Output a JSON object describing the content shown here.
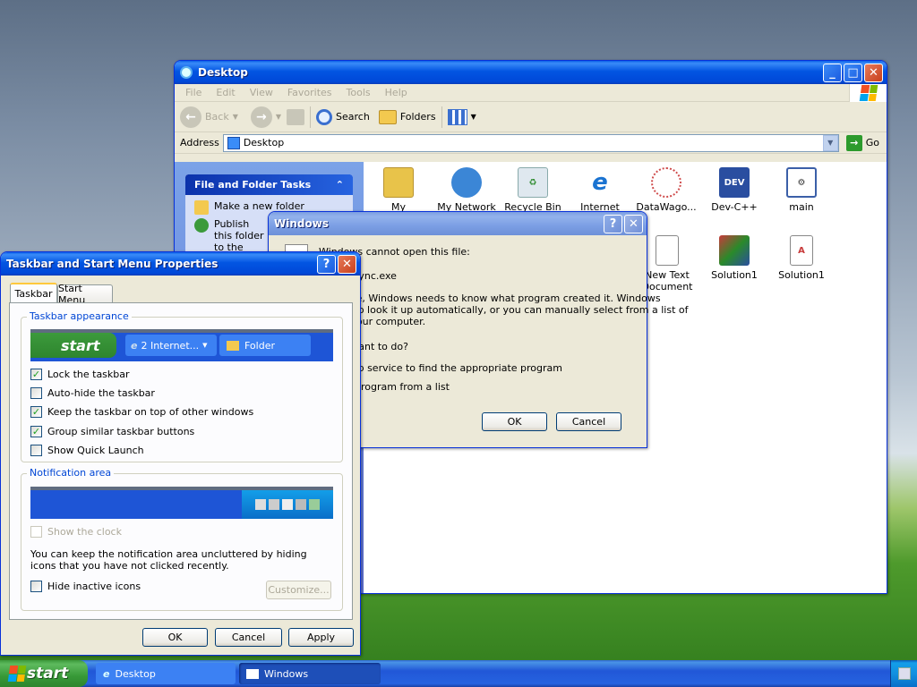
{
  "explorer": {
    "title": "Desktop",
    "menu": [
      "File",
      "Edit",
      "View",
      "Favorites",
      "Tools",
      "Help"
    ],
    "toolbar": {
      "back": "Back",
      "search": "Search",
      "folders": "Folders"
    },
    "address_label": "Address",
    "address_value": "Desktop",
    "go_label": "Go",
    "tasks_header": "File and Folder Tasks",
    "tasks": [
      "Make a new folder",
      "Publish this folder to the Web"
    ],
    "icons": [
      {
        "label": "My Documents",
        "icon": "folder-docs-icon",
        "color": "#e8c34a"
      },
      {
        "label": "My Network",
        "icon": "network-globe-icon",
        "color": "#3b86d6"
      },
      {
        "label": "Recycle Bin",
        "icon": "recycle-bin-icon",
        "color": "#6fae6f"
      },
      {
        "label": "Internet",
        "icon": "internet-explorer-icon",
        "color": "#1a73d1"
      },
      {
        "label": "DataWago...",
        "icon": "datawago-shortcut-icon",
        "color": "#cf4b4b"
      },
      {
        "label": "Dev-C++",
        "icon": "devcpp-shortcut-icon",
        "color": "#2a4ea0"
      },
      {
        "label": "main",
        "icon": "exe-window-icon",
        "color": "#5a5a5a"
      },
      {
        "label": "New Text Document",
        "icon": "text-document-icon",
        "color": "#ffffff"
      },
      {
        "label": "Solution1",
        "icon": "solution-file-icon",
        "color": "#c83b3b"
      },
      {
        "label": "Solution1",
        "icon": "solution-doc-icon",
        "color": "#ffffff"
      }
    ]
  },
  "windows_dialog": {
    "title": "Windows",
    "line1": "Windows cannot open this file:",
    "filename": "File: cbsync.exe",
    "line2a": "To open this file, Windows needs to know what program created it.  Windows",
    "line2b": "can go online to look it up automatically, or you can manually select from a list of",
    "line2c": "programs on your computer.",
    "question": "What do you want to do?",
    "opt1": "Use the Web service to find the appropriate program",
    "opt2": "Select the program from a list",
    "ok": "OK",
    "cancel": "Cancel"
  },
  "taskbar_props": {
    "title": "Taskbar and Start Menu Properties",
    "tabs": [
      "Taskbar",
      "Start Menu"
    ],
    "group1": "Taskbar appearance",
    "preview_start": "start",
    "preview_task1": "2 Internet...",
    "preview_task2": "Folder",
    "checks": [
      {
        "label": "Lock the taskbar",
        "checked": true
      },
      {
        "label": "Auto-hide the taskbar",
        "checked": false
      },
      {
        "label": "Keep the taskbar on top of other windows",
        "checked": true
      },
      {
        "label": "Group similar taskbar buttons",
        "checked": true
      },
      {
        "label": "Show Quick Launch",
        "checked": false
      }
    ],
    "group2": "Notification area",
    "show_clock": "Show the clock",
    "note": "You can keep the notification area uncluttered by hiding icons that you have not clicked recently.",
    "hide_inactive": "Hide inactive icons",
    "customize": "Customize...",
    "ok": "OK",
    "cancel": "Cancel",
    "apply": "Apply"
  },
  "taskbar": {
    "start": "start",
    "tasks": [
      "Desktop",
      "Windows"
    ]
  }
}
